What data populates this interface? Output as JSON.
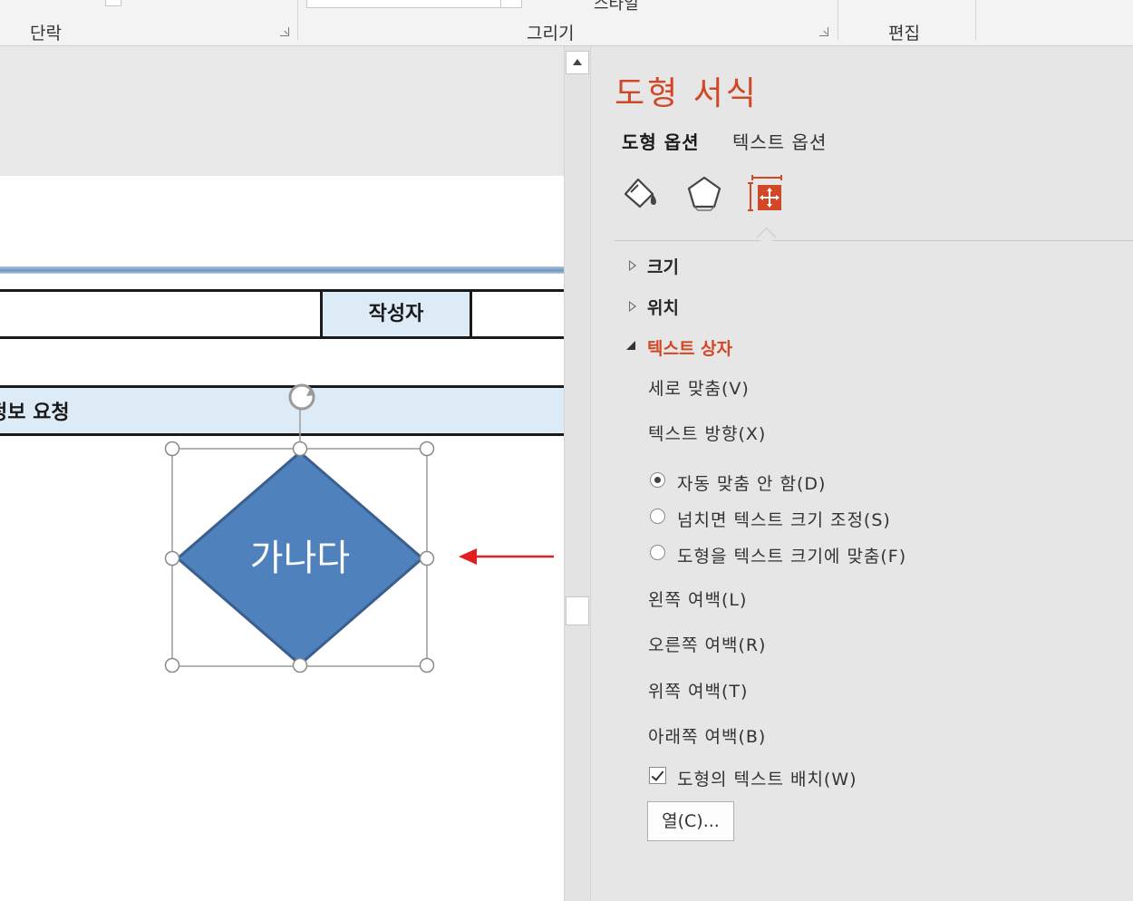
{
  "ribbon": {
    "groups": [
      {
        "label": "단락"
      },
      {
        "label": "그리기"
      },
      {
        "label": "편집"
      }
    ],
    "cutoff_text": "스타일"
  },
  "document": {
    "author_header": "작성자",
    "request_row_text": "정보 요청",
    "shape": {
      "type": "diamond",
      "text": "가나다",
      "fill_color": "#4f81bd",
      "border_color": "#3a5f8f",
      "text_color": "#ffffff"
    },
    "annotation_arrow_color": "#e02020"
  },
  "format_pane": {
    "title": "도형 서식",
    "title_color": "#d24726",
    "tabs": [
      {
        "label": "도형 옵션",
        "active": true
      },
      {
        "label": "텍스트 옵션",
        "active": false
      }
    ],
    "icons": [
      {
        "name": "fill-line-icon",
        "active": false
      },
      {
        "name": "effects-icon",
        "active": false
      },
      {
        "name": "size-properties-icon",
        "active": true
      }
    ],
    "sections": [
      {
        "label": "크기",
        "expanded": false
      },
      {
        "label": "위치",
        "expanded": false
      },
      {
        "label": "텍스트 상자",
        "expanded": true
      }
    ],
    "textbox": {
      "vertical_align_label": "세로 맞춤(V)",
      "text_direction_label": "텍스트 방향(X)",
      "autofit_options": [
        {
          "label": "자동 맞춤 안 함(D)",
          "selected": true
        },
        {
          "label": "넘치면 텍스트 크기 조정(S)",
          "selected": false
        },
        {
          "label": "도형을 텍스트 크기에 맞춤(F)",
          "selected": false
        }
      ],
      "left_margin_label": "왼쪽 여백(L)",
      "right_margin_label": "오른쪽 여백(R)",
      "top_margin_label": "위쪽 여백(T)",
      "bottom_margin_label": "아래쪽 여백(B)",
      "wrap_text_label": "도형의 텍스트 배치(W)",
      "wrap_text_checked": true,
      "columns_button": "열(C)..."
    }
  }
}
